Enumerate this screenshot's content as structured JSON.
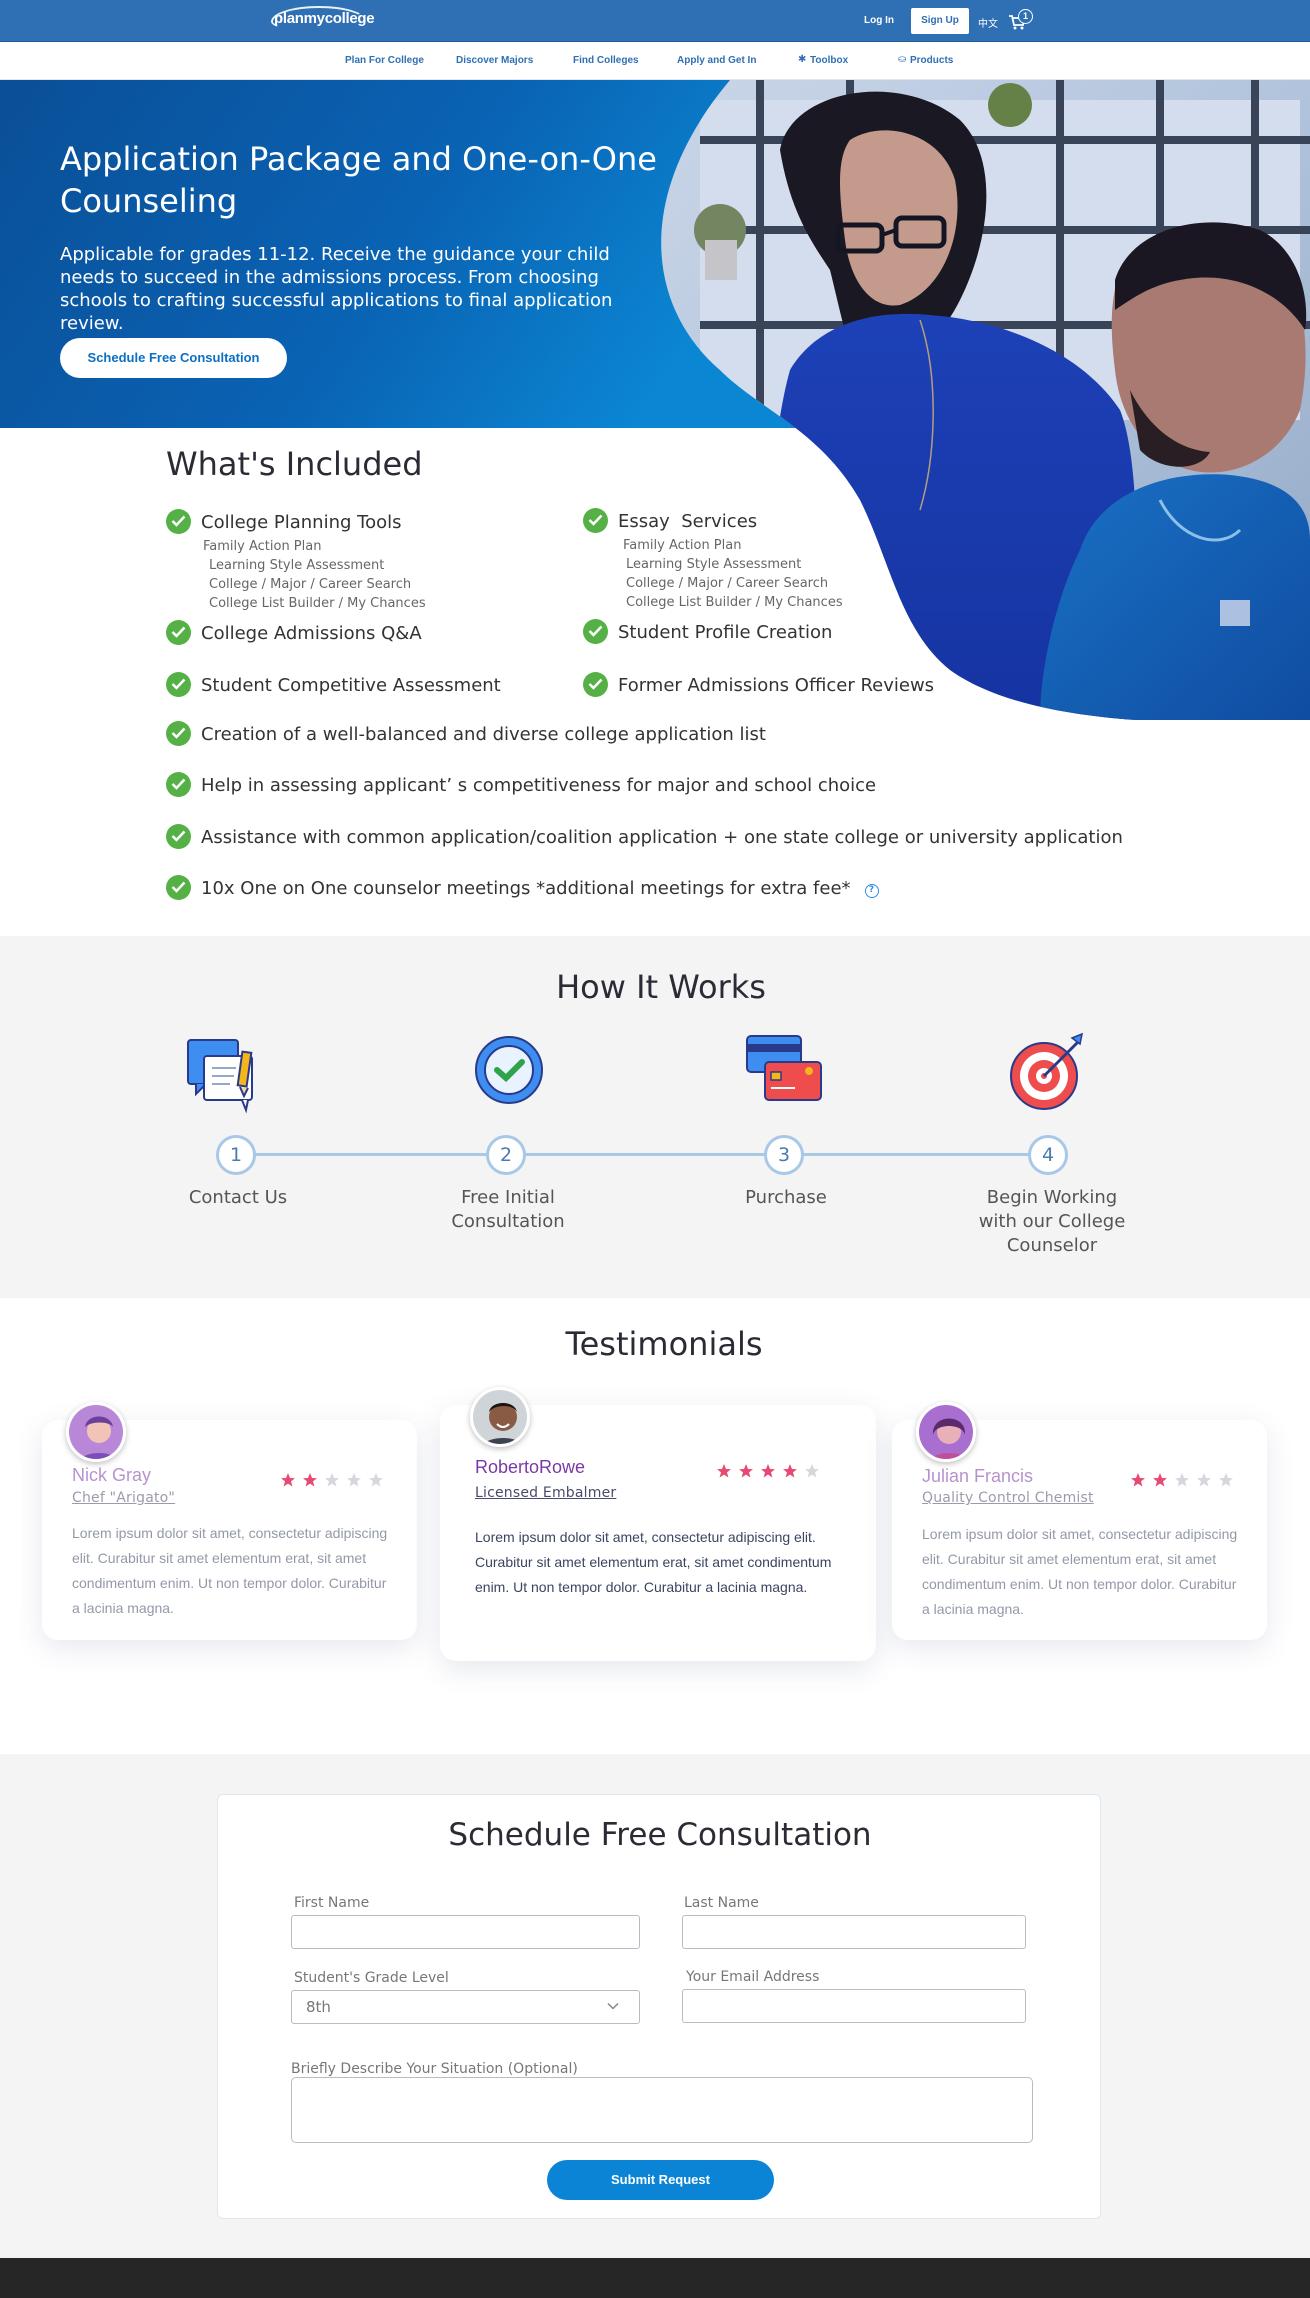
{
  "header": {
    "logo_text": "planmycollege",
    "login": "Log In",
    "signup": "Sign Up",
    "language": "中文",
    "cart_count": "1"
  },
  "nav": {
    "items": [
      "Plan For College",
      "Discover Majors",
      "Find Colleges",
      "Apply and Get In",
      "Toolbox",
      "Products"
    ]
  },
  "hero": {
    "title": "Application Package and One-on-One Counseling",
    "subtitle": "Applicable for grades 11-12. Receive the guidance your child needs to succeed in the admissions process. From choosing schools to crafting successful applications to final application review.",
    "cta": "Schedule Free Consultation"
  },
  "included": {
    "title": "What's Included",
    "planning_tools": {
      "label": "College Planning Tools",
      "subs": [
        "Family Action Plan",
        "Learning Style Assessment",
        "College / Major / Career Search",
        "College List Builder / My Chances"
      ]
    },
    "essay_services": {
      "label": "Essay  Services",
      "subs": [
        "Family Action Plan",
        "Learning Style Assessment",
        "College / Major / Career Search",
        "College List Builder / My Chances"
      ]
    },
    "qa": "College Admissions Q&A",
    "profile": "Student Profile Creation",
    "competitive": "Student Competitive Assessment",
    "officer": "Former Admissions Officer Reviews",
    "list": "Creation of a well-balanced and diverse college application list",
    "assess": "Help in assessing applicant’ s competitiveness for major and school choice",
    "common_app": "Assistance with common application/coalition application + one state college or university application",
    "meetings": "10x One on One counselor meetings *additional meetings for extra fee*"
  },
  "how_it_works": {
    "title": "How It Works",
    "steps": [
      {
        "num": "1",
        "label": "Contact Us"
      },
      {
        "num": "2",
        "label": "Free Initial Consultation"
      },
      {
        "num": "3",
        "label": "Purchase"
      },
      {
        "num": "4",
        "label": "Begin Working with our College Counselor"
      }
    ]
  },
  "testimonials": {
    "title": "Testimonials",
    "cards": [
      {
        "name": "Nick Gray",
        "role": "Chef \"Arigato\"",
        "rating": 2,
        "text": "Lorem ipsum dolor sit amet, consectetur adipiscing elit. Curabitur sit amet elementum erat, sit amet condimentum enim. Ut non tempor dolor. Curabitur a lacinia magna."
      },
      {
        "name": "RobertoRowe",
        "role": "Licensed Embalmer",
        "rating": 4,
        "text": "Lorem ipsum dolor sit amet, consectetur adipiscing elit. Curabitur sit amet elementum erat, sit amet condimentum enim. Ut non tempor dolor. Curabitur a lacinia magna."
      },
      {
        "name": "Julian Francis",
        "role": "Quality Control Chemist",
        "rating": 2,
        "text": "Lorem ipsum dolor sit amet, consectetur adipiscing elit. Curabitur sit amet elementum erat, sit amet condimentum enim. Ut non tempor dolor. Curabitur a lacinia magna."
      }
    ]
  },
  "form": {
    "title": "Schedule Free Consultation",
    "first_name_label": "First Name",
    "last_name_label": "Last Name",
    "grade_label": "Student's Grade Level",
    "grade_value": "8th",
    "email_label": "Your Email Address",
    "situation_label": "Briefly Describe Your Situation (Optional)",
    "submit": "Submit Request"
  },
  "colors": {
    "brand_blue": "#2f6fb3",
    "check_green": "#55b146",
    "star_active": "#e64a73",
    "star_inactive": "#d6d6dc"
  }
}
